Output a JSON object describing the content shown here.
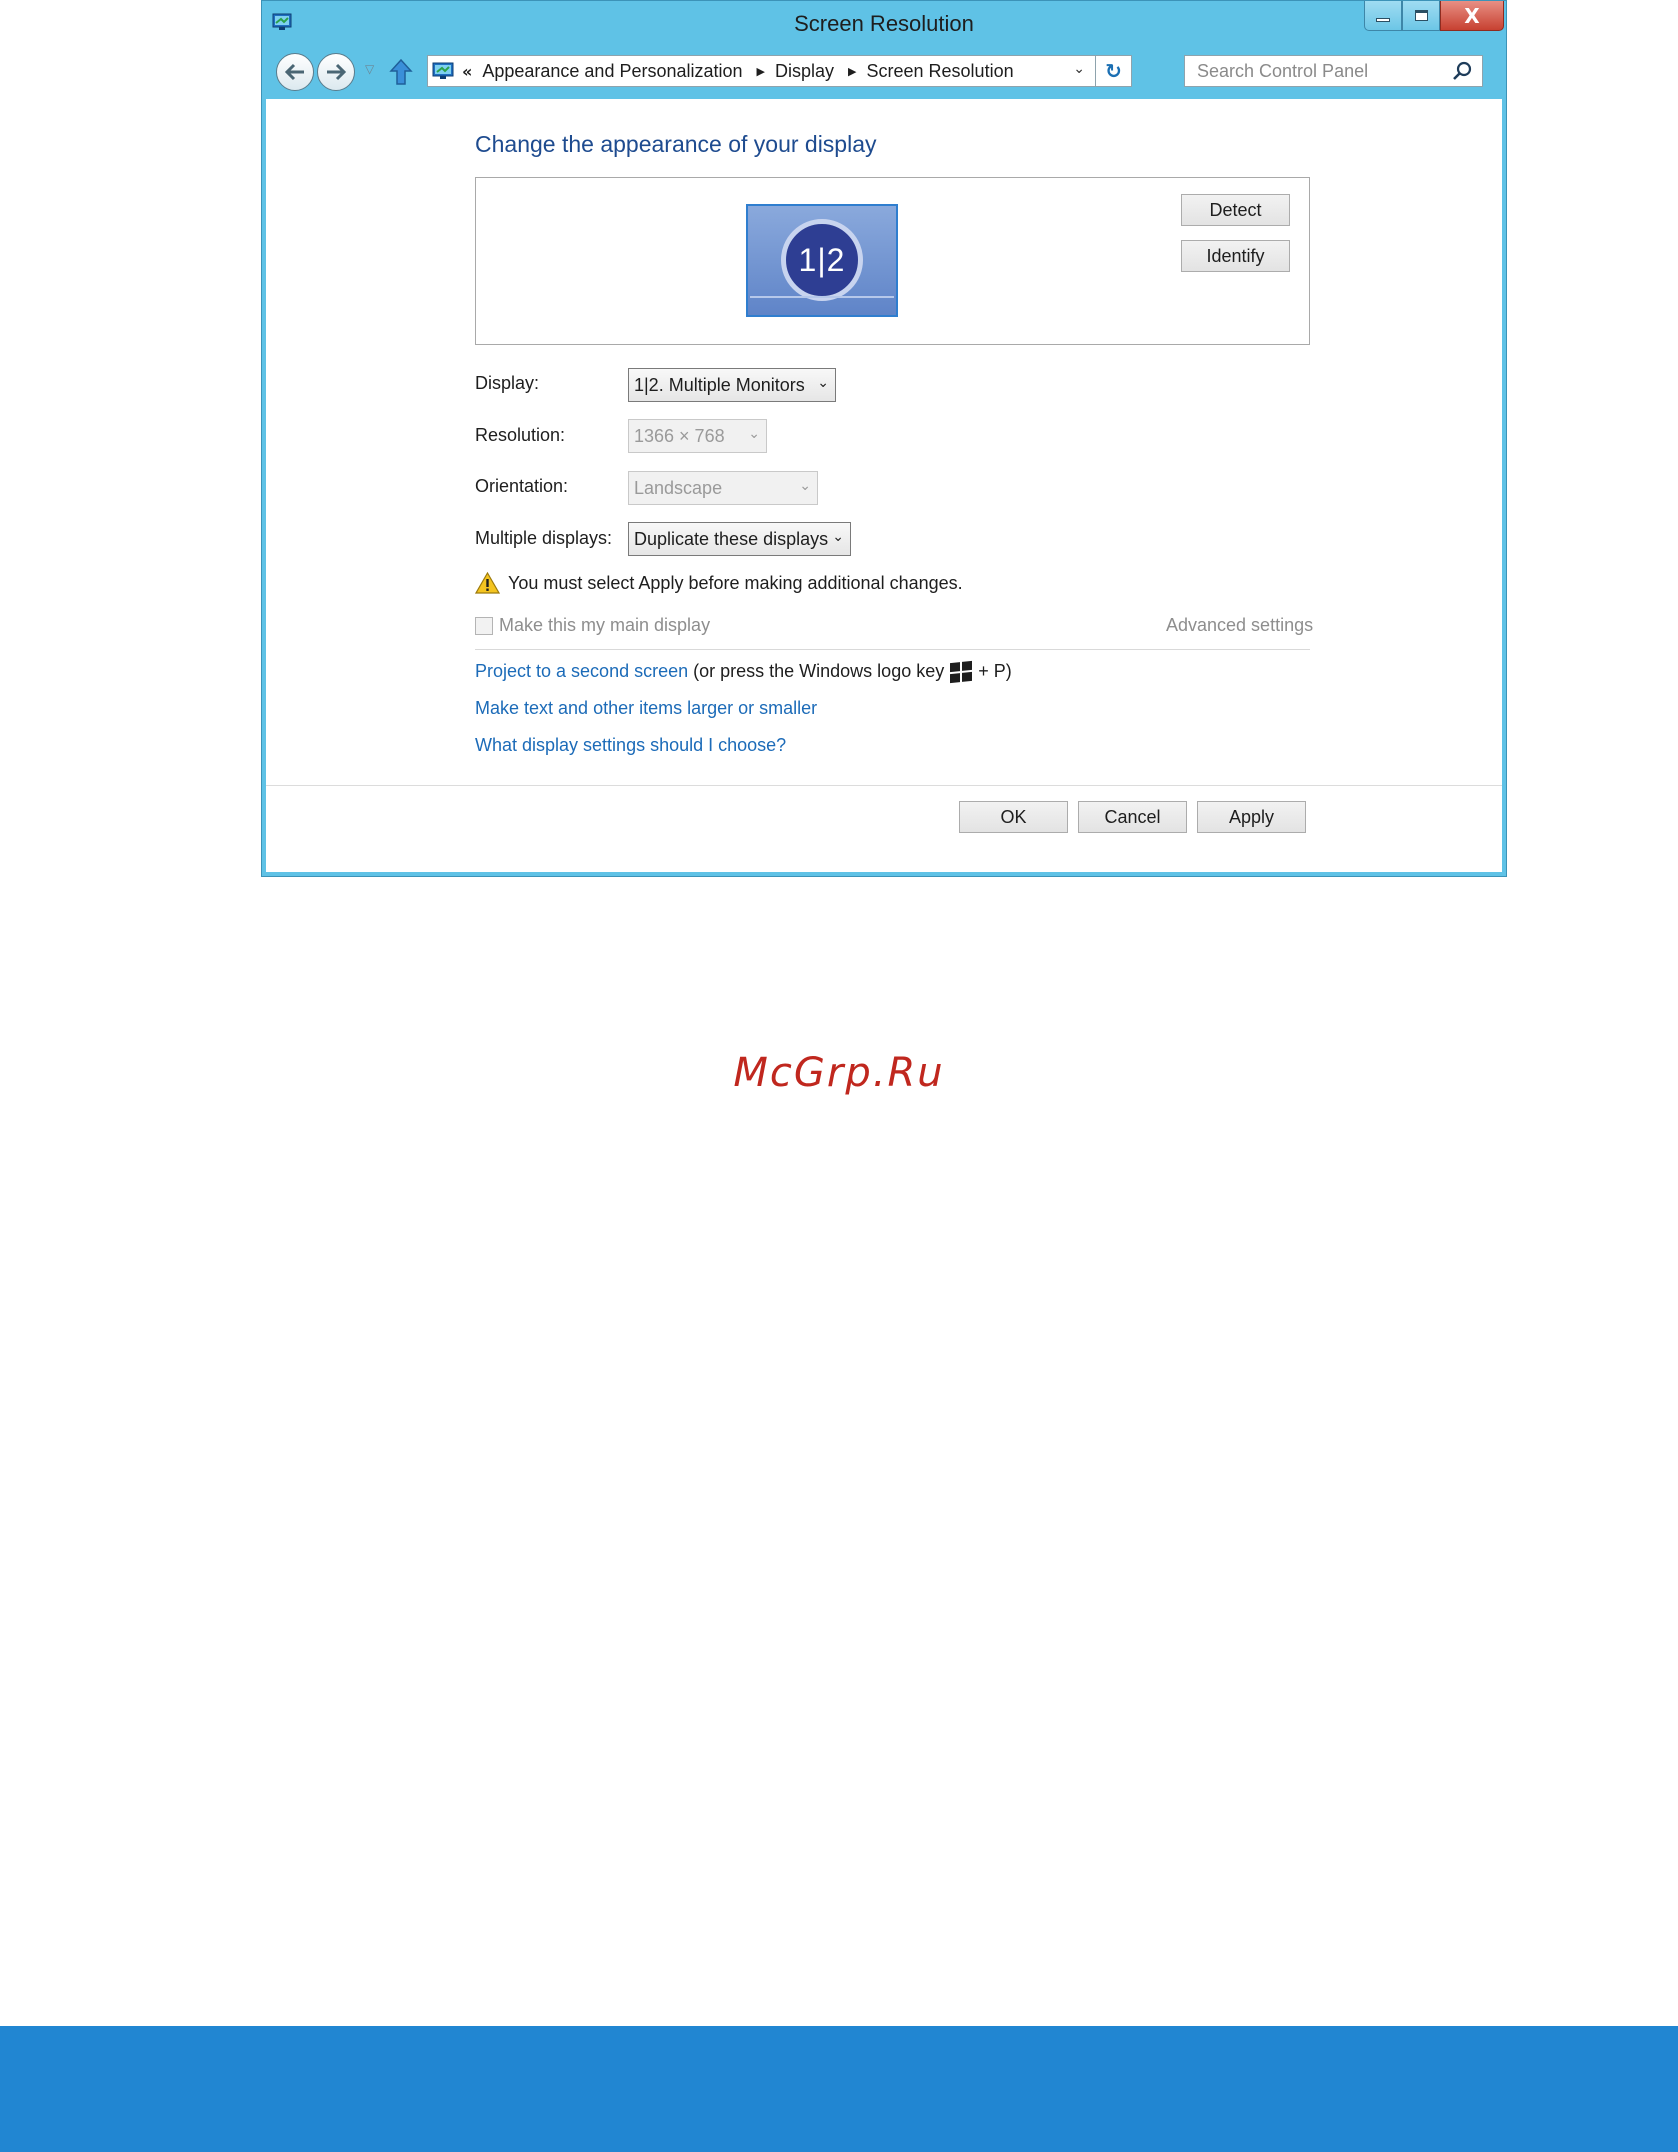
{
  "window": {
    "title": "Screen Resolution"
  },
  "title_buttons": {
    "close_glyph": "X"
  },
  "navigation": {
    "breadcrumb_prefix": "«",
    "breadcrumbs": [
      "Appearance and Personalization",
      "Display",
      "Screen Resolution"
    ],
    "search_placeholder": "Search Control Panel"
  },
  "content": {
    "heading": "Change the appearance of your display",
    "monitor_label": "1|2",
    "detect_button": "Detect",
    "identify_button": "Identify",
    "display_label": "Display:",
    "display_value": "1|2. Multiple Monitors",
    "resolution_label": "Resolution:",
    "resolution_value": "1366 × 768",
    "orientation_label": "Orientation:",
    "orientation_value": "Landscape",
    "multiple_displays_label": "Multiple displays:",
    "multiple_displays_value": "Duplicate these displays",
    "warning_text": "You must select Apply before making additional changes.",
    "main_display_checkbox": "Make this my main display",
    "main_display_checked": false,
    "advanced_settings": "Advanced settings",
    "project_link": "Project to a second screen",
    "project_suffix_before_key": "(or press the Windows logo key",
    "project_suffix_after_key": "+ P)",
    "text_size_link": "Make text and other items larger or smaller",
    "help_link": "What display settings should I choose?"
  },
  "footer_buttons": {
    "ok": "OK",
    "cancel": "Cancel",
    "apply": "Apply"
  },
  "page": {
    "watermark": "McGrp.Ru"
  },
  "colors": {
    "window_frame": "#5fc2e6",
    "link": "#1c6bb8",
    "heading": "#1e4b8f",
    "footer_bar": "#2186d2",
    "watermark": "#c0271e"
  }
}
